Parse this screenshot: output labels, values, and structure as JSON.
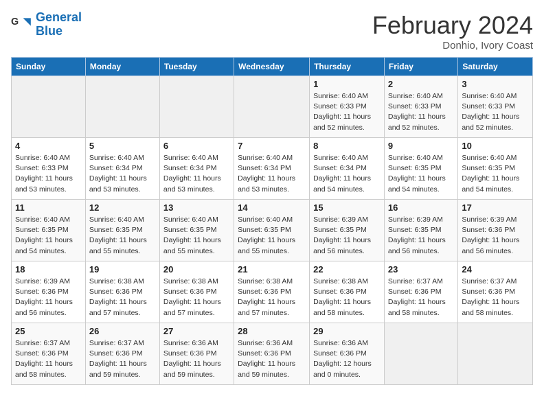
{
  "header": {
    "logo_line1": "General",
    "logo_line2": "Blue",
    "month_title": "February 2024",
    "location": "Donhio, Ivory Coast"
  },
  "weekdays": [
    "Sunday",
    "Monday",
    "Tuesday",
    "Wednesday",
    "Thursday",
    "Friday",
    "Saturday"
  ],
  "weeks": [
    [
      {
        "day": "",
        "info": ""
      },
      {
        "day": "",
        "info": ""
      },
      {
        "day": "",
        "info": ""
      },
      {
        "day": "",
        "info": ""
      },
      {
        "day": "1",
        "info": "Sunrise: 6:40 AM\nSunset: 6:33 PM\nDaylight: 11 hours\nand 52 minutes."
      },
      {
        "day": "2",
        "info": "Sunrise: 6:40 AM\nSunset: 6:33 PM\nDaylight: 11 hours\nand 52 minutes."
      },
      {
        "day": "3",
        "info": "Sunrise: 6:40 AM\nSunset: 6:33 PM\nDaylight: 11 hours\nand 52 minutes."
      }
    ],
    [
      {
        "day": "4",
        "info": "Sunrise: 6:40 AM\nSunset: 6:33 PM\nDaylight: 11 hours\nand 53 minutes."
      },
      {
        "day": "5",
        "info": "Sunrise: 6:40 AM\nSunset: 6:34 PM\nDaylight: 11 hours\nand 53 minutes."
      },
      {
        "day": "6",
        "info": "Sunrise: 6:40 AM\nSunset: 6:34 PM\nDaylight: 11 hours\nand 53 minutes."
      },
      {
        "day": "7",
        "info": "Sunrise: 6:40 AM\nSunset: 6:34 PM\nDaylight: 11 hours\nand 53 minutes."
      },
      {
        "day": "8",
        "info": "Sunrise: 6:40 AM\nSunset: 6:34 PM\nDaylight: 11 hours\nand 54 minutes."
      },
      {
        "day": "9",
        "info": "Sunrise: 6:40 AM\nSunset: 6:35 PM\nDaylight: 11 hours\nand 54 minutes."
      },
      {
        "day": "10",
        "info": "Sunrise: 6:40 AM\nSunset: 6:35 PM\nDaylight: 11 hours\nand 54 minutes."
      }
    ],
    [
      {
        "day": "11",
        "info": "Sunrise: 6:40 AM\nSunset: 6:35 PM\nDaylight: 11 hours\nand 54 minutes."
      },
      {
        "day": "12",
        "info": "Sunrise: 6:40 AM\nSunset: 6:35 PM\nDaylight: 11 hours\nand 55 minutes."
      },
      {
        "day": "13",
        "info": "Sunrise: 6:40 AM\nSunset: 6:35 PM\nDaylight: 11 hours\nand 55 minutes."
      },
      {
        "day": "14",
        "info": "Sunrise: 6:40 AM\nSunset: 6:35 PM\nDaylight: 11 hours\nand 55 minutes."
      },
      {
        "day": "15",
        "info": "Sunrise: 6:39 AM\nSunset: 6:35 PM\nDaylight: 11 hours\nand 56 minutes."
      },
      {
        "day": "16",
        "info": "Sunrise: 6:39 AM\nSunset: 6:35 PM\nDaylight: 11 hours\nand 56 minutes."
      },
      {
        "day": "17",
        "info": "Sunrise: 6:39 AM\nSunset: 6:36 PM\nDaylight: 11 hours\nand 56 minutes."
      }
    ],
    [
      {
        "day": "18",
        "info": "Sunrise: 6:39 AM\nSunset: 6:36 PM\nDaylight: 11 hours\nand 56 minutes."
      },
      {
        "day": "19",
        "info": "Sunrise: 6:38 AM\nSunset: 6:36 PM\nDaylight: 11 hours\nand 57 minutes."
      },
      {
        "day": "20",
        "info": "Sunrise: 6:38 AM\nSunset: 6:36 PM\nDaylight: 11 hours\nand 57 minutes."
      },
      {
        "day": "21",
        "info": "Sunrise: 6:38 AM\nSunset: 6:36 PM\nDaylight: 11 hours\nand 57 minutes."
      },
      {
        "day": "22",
        "info": "Sunrise: 6:38 AM\nSunset: 6:36 PM\nDaylight: 11 hours\nand 58 minutes."
      },
      {
        "day": "23",
        "info": "Sunrise: 6:37 AM\nSunset: 6:36 PM\nDaylight: 11 hours\nand 58 minutes."
      },
      {
        "day": "24",
        "info": "Sunrise: 6:37 AM\nSunset: 6:36 PM\nDaylight: 11 hours\nand 58 minutes."
      }
    ],
    [
      {
        "day": "25",
        "info": "Sunrise: 6:37 AM\nSunset: 6:36 PM\nDaylight: 11 hours\nand 58 minutes."
      },
      {
        "day": "26",
        "info": "Sunrise: 6:37 AM\nSunset: 6:36 PM\nDaylight: 11 hours\nand 59 minutes."
      },
      {
        "day": "27",
        "info": "Sunrise: 6:36 AM\nSunset: 6:36 PM\nDaylight: 11 hours\nand 59 minutes."
      },
      {
        "day": "28",
        "info": "Sunrise: 6:36 AM\nSunset: 6:36 PM\nDaylight: 11 hours\nand 59 minutes."
      },
      {
        "day": "29",
        "info": "Sunrise: 6:36 AM\nSunset: 6:36 PM\nDaylight: 12 hours\nand 0 minutes."
      },
      {
        "day": "",
        "info": ""
      },
      {
        "day": "",
        "info": ""
      }
    ]
  ]
}
